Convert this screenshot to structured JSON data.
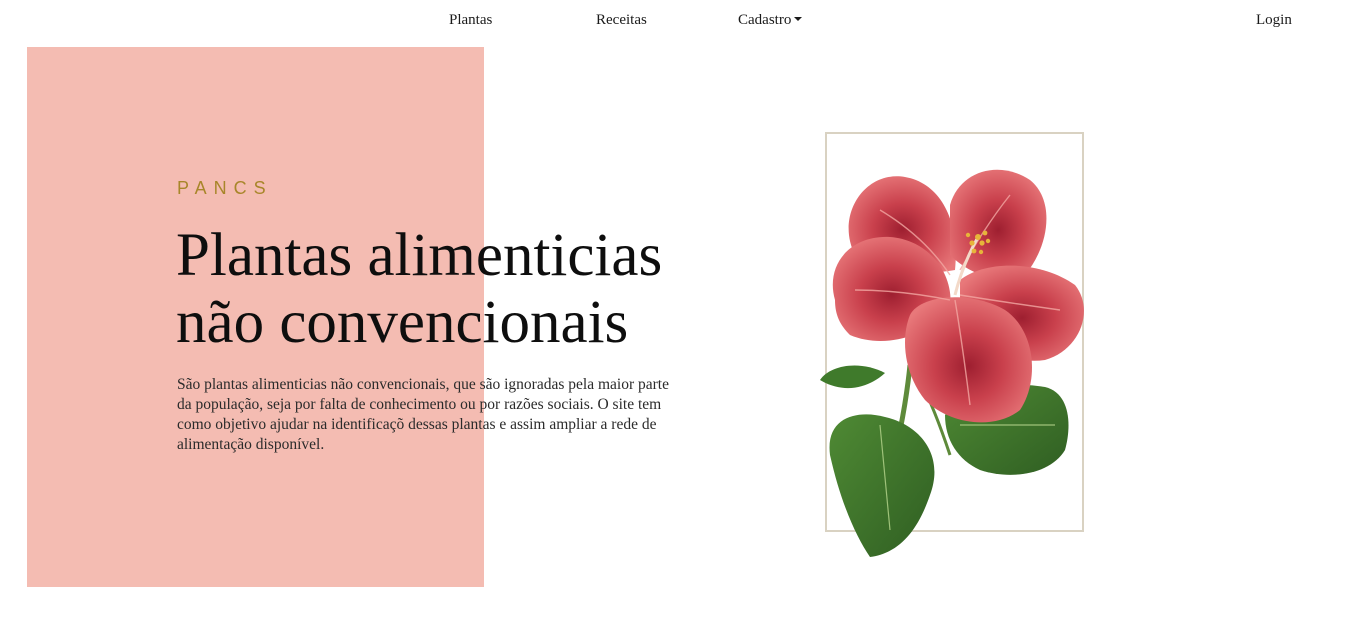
{
  "nav": {
    "items": [
      {
        "label": "Plantas"
      },
      {
        "label": "Receitas"
      },
      {
        "label": "Cadastro",
        "has_dropdown": true
      }
    ],
    "login_label": "Login"
  },
  "hero": {
    "eyebrow": "PANCS",
    "title_line1": "Plantas alimenticias",
    "title_line2": "não convencionais",
    "description": "São plantas alimenticias não convencionais, que são ignoradas pela maior parte da população, seja por falta de conhecimento ou por razões sociais. O site tem como objetivo ajudar na identificaçõ dessas plantas e assim ampliar a rede de alimentação disponível.",
    "accent_color": "#f4bcb2",
    "eyebrow_color": "#a8862a",
    "illustration": "hibiscus-flower-illustration"
  }
}
